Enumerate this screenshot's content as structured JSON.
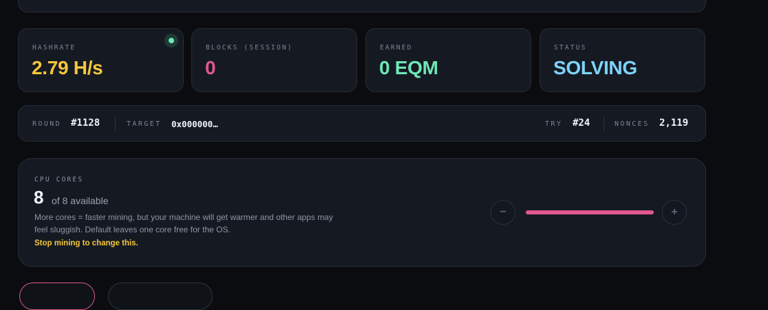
{
  "stats": {
    "hashrate": {
      "label": "HASHRATE",
      "value": "2.79 H/s",
      "color": "#f5c63b"
    },
    "blocks": {
      "label": "BLOCKS (SESSION)",
      "value": "0",
      "color": "#e0578e"
    },
    "earned": {
      "label": "EARNED",
      "value": "0 EQM",
      "color": "#6ee7b7"
    },
    "status": {
      "label": "STATUS",
      "value": "SOLVING",
      "color": "#7dd3fc"
    }
  },
  "round_bar": {
    "round_label": "ROUND",
    "round_value": "#1128",
    "target_label": "TARGET",
    "target_value": "0x000000…",
    "try_label": "TRY",
    "try_value": "#24",
    "nonces_label": "NONCES",
    "nonces_value": "2,119"
  },
  "cpu": {
    "label": "CPU CORES",
    "count": "8",
    "available": "of 8 available",
    "description": "More cores = faster mining, but your machine will get warmer and other apps may feel sluggish. Default leaves one core free for the OS.",
    "warning": "Stop mining to change this.",
    "decrease_symbol": "−",
    "increase_symbol": "+",
    "slider_fraction": 1.0
  },
  "colors": {
    "accent_pink": "#e0578e",
    "accent_yellow": "#f5c63b",
    "accent_green": "#6ee7b7",
    "accent_blue": "#7dd3fc"
  }
}
